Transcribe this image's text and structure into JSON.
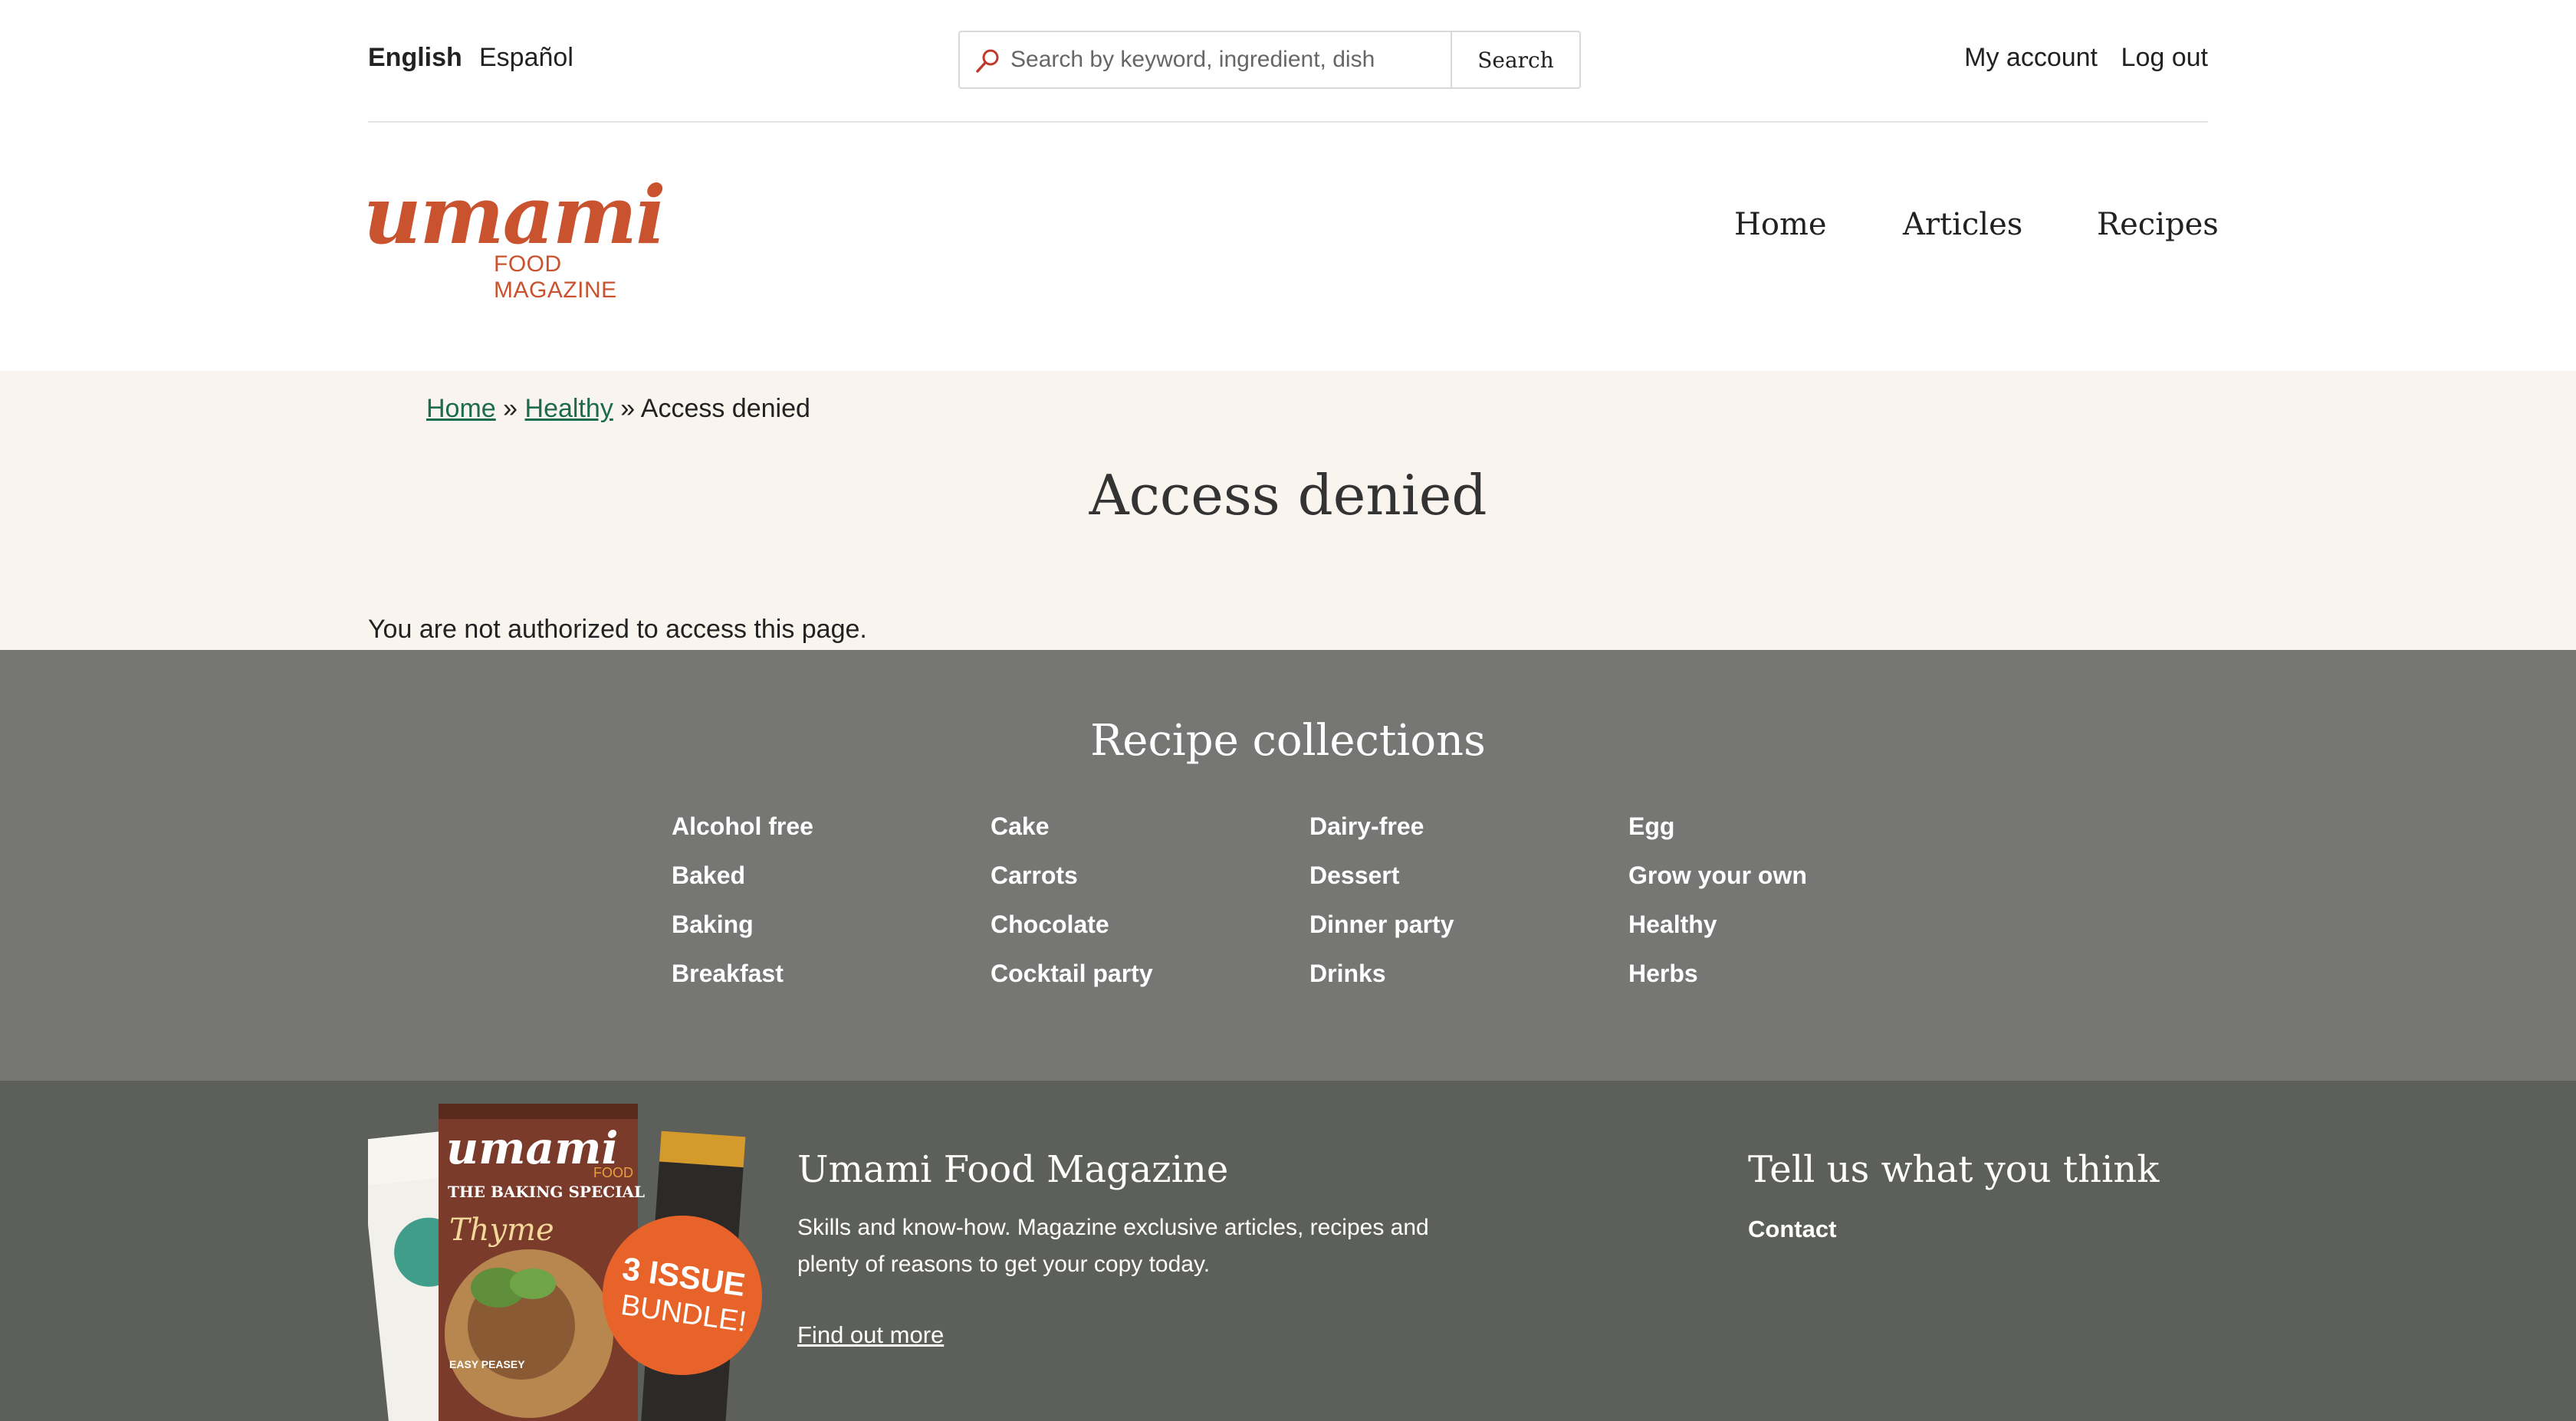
{
  "top": {
    "languages": [
      "English",
      "Español"
    ],
    "search": {
      "placeholder": "Search by keyword, ingredient, dish",
      "button": "Search"
    },
    "account": [
      "My account",
      "Log out"
    ]
  },
  "logo": {
    "word": "umami",
    "tagline": "FOOD MAGAZINE"
  },
  "nav": [
    "Home",
    "Articles",
    "Recipes"
  ],
  "breadcrumb": {
    "home": "Home",
    "sep1": "»",
    "healthy": "Healthy",
    "sep2": "»",
    "current": "Access denied"
  },
  "page": {
    "title": "Access denied",
    "message": "You are not authorized to access this page."
  },
  "collections": {
    "title": "Recipe collections",
    "columns": [
      [
        "Alcohol free",
        "Baked",
        "Baking",
        "Breakfast"
      ],
      [
        "Cake",
        "Carrots",
        "Chocolate",
        "Cocktail party"
      ],
      [
        "Dairy-free",
        "Dessert",
        "Dinner party",
        "Drinks"
      ],
      [
        "Egg",
        "Grow your own",
        "Healthy",
        "Herbs"
      ]
    ]
  },
  "footer": {
    "magazine": {
      "title": "Umami Food Magazine",
      "description": "Skills and know-how. Magazine exclusive articles, recipes and plenty of reasons to get your copy today.",
      "link": "Find out more",
      "image": {
        "cover_word": "umami",
        "cover_sub": "FOOD",
        "special": "THE BAKING SPECIAL",
        "feature": "Thyme",
        "easy": "EASY PEASEY",
        "badge_1": "3 ISSUE",
        "badge_2": "BUNDLE!"
      }
    },
    "contact": {
      "title": "Tell us what you think",
      "link": "Contact"
    }
  },
  "colors": {
    "brand": "#c9532f",
    "link_green": "#1d6b4c",
    "content_bg": "#f9f4ee",
    "collections_bg": "#767674",
    "footer_bg": "#5d5f5a",
    "badge": "#e8632a"
  }
}
